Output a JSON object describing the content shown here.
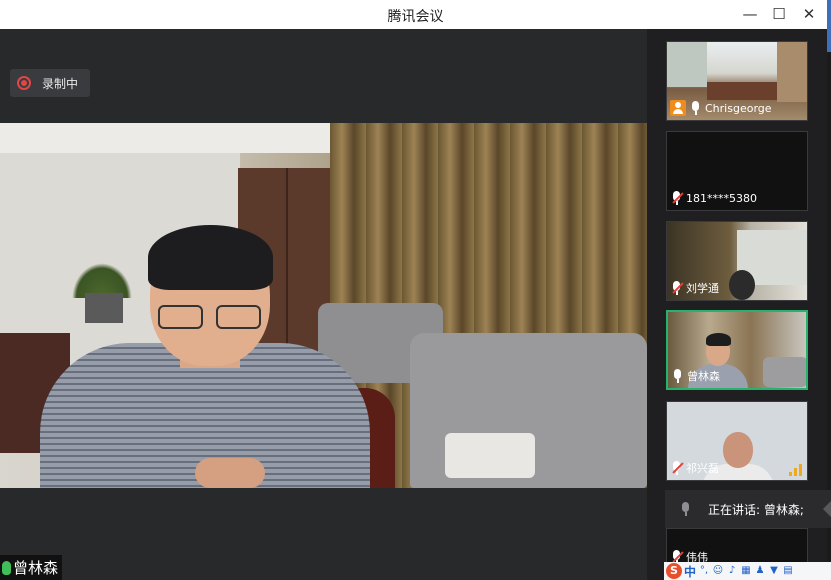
{
  "window": {
    "title": "腾讯会议",
    "minimize_glyph": "—",
    "maximize_glyph": "☐",
    "close_glyph": "✕"
  },
  "recording": {
    "label": "录制中",
    "color": "#e04646"
  },
  "main_video": {
    "speaker_name": "曾林森",
    "speaker_mic_color": "#3fbe5a"
  },
  "participants": [
    {
      "name": "Chrisgeorge",
      "mic": "on",
      "is_host": true,
      "active": false
    },
    {
      "name": "181****5380",
      "mic": "muted",
      "is_host": false,
      "active": false
    },
    {
      "name": "刘学通",
      "mic": "muted",
      "is_host": false,
      "active": false
    },
    {
      "name": "曾林森",
      "mic": "on",
      "is_host": false,
      "active": true
    },
    {
      "name": "祁兴磊",
      "mic": "muted",
      "is_host": false,
      "active": false,
      "signal": "weak"
    },
    {
      "name": "伟伟",
      "mic": "muted",
      "is_host": false,
      "active": false
    }
  ],
  "speaking": {
    "text": "正在讲话: 曾林森;"
  },
  "ime_tray": {
    "brand": "S",
    "mode": "中",
    "punct": "°,",
    "icons": [
      "emoji-icon",
      "voice-icon",
      "keyboard-icon",
      "user-icon",
      "shirt-icon",
      "grid-icon"
    ]
  },
  "colors": {
    "active_border": "#27b36b",
    "host_badge": "#f08c1e",
    "muted_slash": "#e2413b",
    "signal": "#f2a81c"
  }
}
